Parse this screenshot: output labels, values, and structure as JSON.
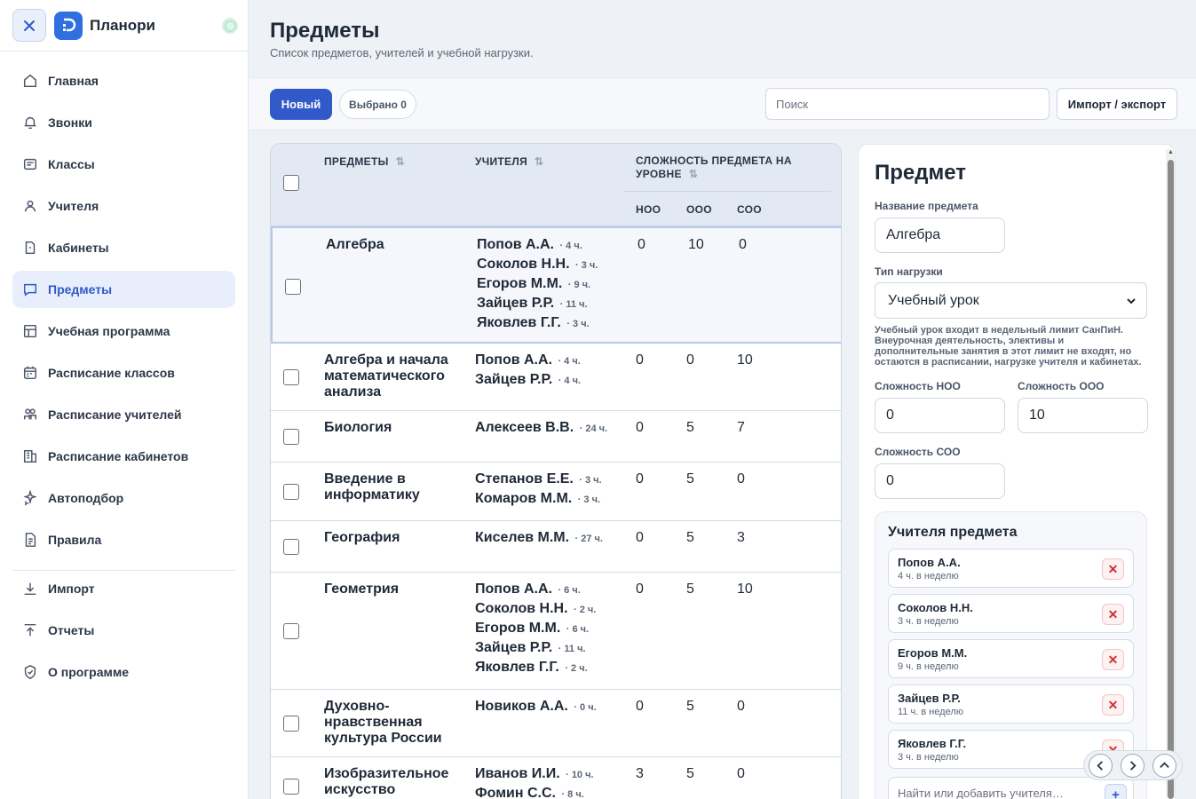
{
  "app": {
    "title": "Планори"
  },
  "sidebar": {
    "items": [
      {
        "label": "Главная",
        "icon": "home-icon"
      },
      {
        "label": "Звонки",
        "icon": "bell-icon"
      },
      {
        "label": "Классы",
        "icon": "class-icon"
      },
      {
        "label": "Учителя",
        "icon": "user-icon"
      },
      {
        "label": "Кабинеты",
        "icon": "door-icon"
      },
      {
        "label": "Предметы",
        "icon": "chat-icon",
        "active": true
      },
      {
        "label": "Учебная программа",
        "icon": "table-icon"
      },
      {
        "label": "Расписание классов",
        "icon": "calendar-icon"
      },
      {
        "label": "Расписание учителей",
        "icon": "users-icon"
      },
      {
        "label": "Расписание кабинетов",
        "icon": "building-icon"
      },
      {
        "label": "Автоподбор",
        "icon": "sparkles-icon"
      },
      {
        "label": "Правила",
        "icon": "document-icon"
      }
    ],
    "bottom_items": [
      {
        "label": "Импорт",
        "icon": "download-icon"
      },
      {
        "label": "Отчеты",
        "icon": "upload-icon"
      },
      {
        "label": "О программе",
        "icon": "shield-icon"
      }
    ]
  },
  "page": {
    "title": "Предметы",
    "subtitle": "Список предметов, учителей и учебной нагрузки."
  },
  "toolbar": {
    "new_label": "Новый",
    "selected_label": "Выбрано 0",
    "search_placeholder": "Поиск",
    "import_label": "Импорт / экспорт"
  },
  "table": {
    "headers": {
      "subjects": "ПРЕДМЕТЫ",
      "teachers": "УЧИТЕЛЯ",
      "complexity": "СЛОЖНОСТЬ ПРЕДМЕТА НА УРОВНЕ",
      "noo": "НОО",
      "ooo": "ООО",
      "soo": "СОО"
    },
    "rows": [
      {
        "subject": "Алгебра",
        "teachers": [
          {
            "name": "Попов А.А.",
            "hours": "· 4 ч."
          },
          {
            "name": "Соколов Н.Н.",
            "hours": "· 3 ч."
          },
          {
            "name": "Егоров М.М.",
            "hours": "· 9 ч."
          },
          {
            "name": "Зайцев Р.Р.",
            "hours": "· 11 ч."
          },
          {
            "name": "Яковлев Г.Г.",
            "hours": "· 3 ч."
          }
        ],
        "noo": "0",
        "ooo": "10",
        "soo": "0",
        "selected": true
      },
      {
        "subject": "Алгебра и начала математического анализа",
        "teachers": [
          {
            "name": "Попов А.А.",
            "hours": "· 4 ч."
          },
          {
            "name": "Зайцев Р.Р.",
            "hours": "· 4 ч."
          }
        ],
        "noo": "0",
        "ooo": "0",
        "soo": "10"
      },
      {
        "subject": "Биология",
        "teachers": [
          {
            "name": "Алексеев В.В.",
            "hours": "· 24 ч."
          }
        ],
        "noo": "0",
        "ooo": "5",
        "soo": "7"
      },
      {
        "subject": "Введение в информатику",
        "teachers": [
          {
            "name": "Степанов Е.Е.",
            "hours": "· 3 ч."
          },
          {
            "name": "Комаров М.М.",
            "hours": "· 3 ч."
          }
        ],
        "noo": "0",
        "ooo": "5",
        "soo": "0"
      },
      {
        "subject": "География",
        "teachers": [
          {
            "name": "Киселев М.М.",
            "hours": "· 27 ч."
          }
        ],
        "noo": "0",
        "ooo": "5",
        "soo": "3"
      },
      {
        "subject": "Геометрия",
        "teachers": [
          {
            "name": "Попов А.А.",
            "hours": "· 6 ч."
          },
          {
            "name": "Соколов Н.Н.",
            "hours": "· 2 ч."
          },
          {
            "name": "Егоров М.М.",
            "hours": "· 6 ч."
          },
          {
            "name": "Зайцев Р.Р.",
            "hours": "· 11 ч."
          },
          {
            "name": "Яковлев Г.Г.",
            "hours": "· 2 ч."
          }
        ],
        "noo": "0",
        "ooo": "5",
        "soo": "10"
      },
      {
        "subject": "Духовно-нравственная культура России",
        "teachers": [
          {
            "name": "Новиков А.А.",
            "hours": "· 0 ч."
          }
        ],
        "noo": "0",
        "ooo": "5",
        "soo": "0"
      },
      {
        "subject": "Изобразительное искусство",
        "teachers": [
          {
            "name": "Иванов И.И.",
            "hours": "· 10 ч."
          },
          {
            "name": "Фомин С.С.",
            "hours": "· 8 ч."
          }
        ],
        "noo": "3",
        "ooo": "5",
        "soo": "0"
      }
    ]
  },
  "panel": {
    "title": "Предмет",
    "name_label": "Название предмета",
    "name_value": "Алгебра",
    "type_label": "Тип нагрузки",
    "type_value": "Учебный урок",
    "hint": "Учебный урок входит в недельный лимит СанПиН. Внеурочная деятельность, элективы и дополнительные занятия в этот лимит не входят, но остаются в расписании, нагрузке учителя и кабинетах.",
    "noo_label": "Сложность НОО",
    "noo_value": "0",
    "ooo_label": "Сложность ООО",
    "ooo_value": "10",
    "soo_label": "Сложность СОО",
    "soo_value": "0",
    "teachers_title": "Учителя предмета",
    "teachers": [
      {
        "name": "Попов А.А.",
        "hours": "4 ч. в неделю"
      },
      {
        "name": "Соколов Н.Н.",
        "hours": "3 ч. в неделю"
      },
      {
        "name": "Егоров М.М.",
        "hours": "9 ч. в неделю"
      },
      {
        "name": "Зайцев Р.Р.",
        "hours": "11 ч. в неделю"
      },
      {
        "name": "Яковлев Г.Г.",
        "hours": "3 ч. в неделю"
      }
    ],
    "find_placeholder": "Найти или добавить учителя…",
    "remove_symbol": "✕",
    "add_symbol": "+"
  },
  "colors": {
    "accent": "#3159c9",
    "danger": "#d32f2f"
  }
}
